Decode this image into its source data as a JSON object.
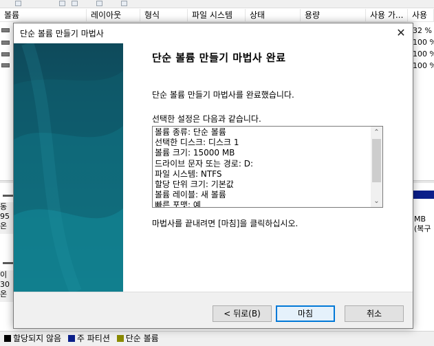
{
  "background": {
    "columns": [
      "볼륨",
      "레이아웃",
      "형식",
      "파일 시스템",
      "상태",
      "용량",
      "사용 가...",
      "사용"
    ],
    "right_values": [
      "32 %",
      "100 %",
      "100 %",
      "100 %"
    ],
    "disk1_left_lines": [
      "동",
      "95",
      "온"
    ],
    "disk2_left_lines": [
      "이",
      "30",
      "온"
    ],
    "disk1_right_lines": [
      "MB",
      "(복구"
    ]
  },
  "legend": [
    {
      "label": "할당되지 않음",
      "color": "#000000"
    },
    {
      "label": "주 파티션",
      "color": "#0b1f8a"
    },
    {
      "label": "단순 볼륨",
      "color": "#8a8a00"
    }
  ],
  "dialog": {
    "title": "단순 볼륨 만들기 마법사",
    "close_glyph": "✕",
    "heading": "단순 볼륨 만들기 마법사 완료",
    "completed_text": "단순 볼륨 만들기 마법사를 완료했습니다.",
    "settings_label": "선택한 설정은 다음과 같습니다.",
    "settings": [
      "볼륨 종류: 단순 볼륨",
      "선택한 디스크: 디스크 1",
      "볼륨 크기: 15000 MB",
      "드라이브 문자 또는 경로: D:",
      "파일 시스템: NTFS",
      "할당 단위 크기: 기본값",
      "볼륨 레이블: 새 볼륨",
      "빠른 포맷: 예"
    ],
    "finish_instruction": "마법사를 끝내려면 [마침]을 클릭하십시오.",
    "buttons": {
      "back": "< 뒤로(B)",
      "finish": "마침",
      "cancel": "취소"
    },
    "scroll_up_glyph": "⌃",
    "scroll_down_glyph": "⌄"
  }
}
